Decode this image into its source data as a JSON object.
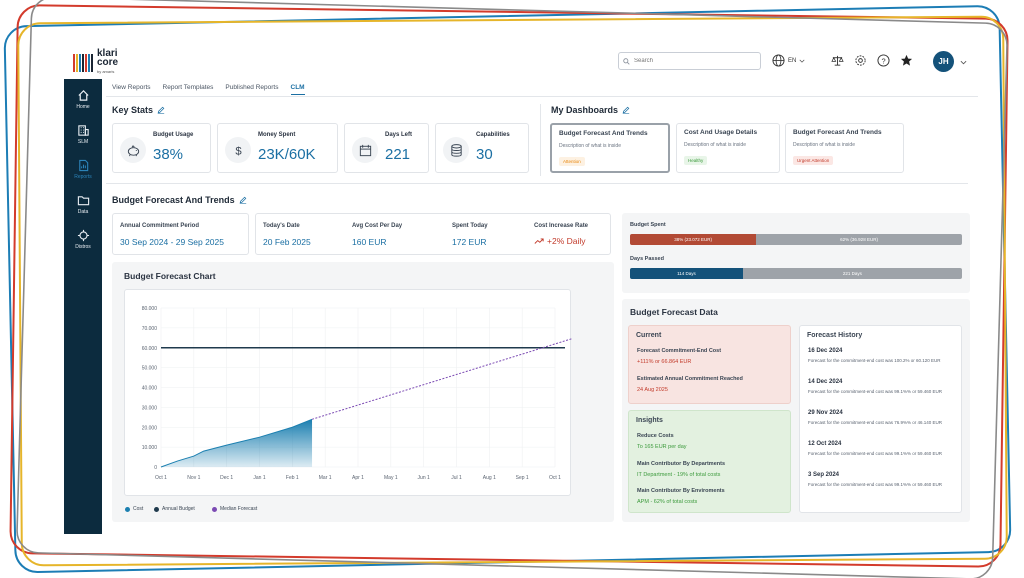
{
  "app": {
    "logo_text_1": "klari",
    "logo_text_2": "core",
    "logo_sub": "by amaris"
  },
  "header": {
    "search_placeholder": "Search",
    "language": "EN",
    "user_initials": "JH"
  },
  "sidebar": {
    "items": [
      {
        "label": "Home",
        "icon": "home-icon"
      },
      {
        "label": "SLM",
        "icon": "building-icon"
      },
      {
        "label": "Reports",
        "icon": "report-icon",
        "active": true
      },
      {
        "label": "Data",
        "icon": "folder-icon"
      },
      {
        "label": "Distros",
        "icon": "distros-icon"
      }
    ]
  },
  "tabs": [
    {
      "label": "View Reports"
    },
    {
      "label": "Report Templates"
    },
    {
      "label": "Published Reports"
    },
    {
      "label": "CLM",
      "active": true
    }
  ],
  "key_stats": {
    "title": "Key Stats",
    "items": [
      {
        "label": "Budget Usage",
        "value": "38%",
        "icon": "piggy-bank-icon"
      },
      {
        "label": "Money Spent",
        "value": "23K/60K",
        "icon": "dollar-icon"
      },
      {
        "label": "Days Left",
        "value": "221",
        "icon": "calendar-icon"
      },
      {
        "label": "Capabilities",
        "value": "30",
        "icon": "database-icon"
      }
    ]
  },
  "my_dashboards": {
    "title": "My Dashboards",
    "items": [
      {
        "title": "Budget Forecast And Trends",
        "description": "Description of what is inside",
        "badge": "Attention",
        "badge_color": "#e8860c",
        "badge_bg": "#fdf1e2"
      },
      {
        "title": "Cost And Usage Details",
        "description": "Description of what is inside",
        "badge": "Healthy",
        "badge_color": "#3c9a3c",
        "badge_bg": "#e8f5e8"
      },
      {
        "title": "Budget Forecast And Trends",
        "description": "Description of what is inside",
        "badge": "Urgent Attention",
        "badge_color": "#c23a2a",
        "badge_bg": "#fbe7e4"
      }
    ]
  },
  "trends": {
    "title": "Budget Forecast And Trends",
    "period_label": "Annual Commitment Period",
    "period_value": "30 Sep 2024 - 29 Sep 2025",
    "metrics": [
      {
        "label": "Today's Date",
        "value": "20 Feb 2025"
      },
      {
        "label": "Avg Cost Per Day",
        "value": "160 EUR"
      },
      {
        "label": "Spent Today",
        "value": "172 EUR"
      },
      {
        "label": "Cost Increase Rate",
        "value": "+2% Daily",
        "color": "#c23a2a"
      }
    ]
  },
  "progress": {
    "budget_spent_label": "Budget Spent",
    "budget_spent_fraction": 0.38,
    "budget_spent_text": "38% (23.072 EUR)",
    "budget_left_text": "62% (36.928 EUR)",
    "days_passed_label": "Days Passed",
    "days_passed_fraction": 0.34,
    "days_passed_text": "114 Days",
    "days_left_text": "221 Days",
    "spent_color": "#b24a35",
    "passed_color": "#14527a",
    "rest_color": "#9ea3a9"
  },
  "chart_data": {
    "type": "area",
    "title": "Budget Forecast Chart",
    "x_ticks": [
      "Oct 1",
      "Nov 1",
      "Dec 1",
      "Jan 1",
      "Feb 1",
      "Mar 1",
      "Apr 1",
      "May 1",
      "Jun 1",
      "Jul 1",
      "Aug 1",
      "Sep 1",
      "Oct 1"
    ],
    "y_ticks": [
      "0",
      "10.000",
      "20.000",
      "30.000",
      "40.000",
      "50.000",
      "60.000",
      "70.000",
      "80.000"
    ],
    "ylim": [
      0,
      80000
    ],
    "series": [
      {
        "name": "Cost",
        "color": "#1b7fb0",
        "x": [
          0,
          0.5,
          1,
          1.3,
          2,
          3,
          4,
          4.6
        ],
        "y": [
          0,
          3000,
          5500,
          8000,
          11000,
          15000,
          20000,
          24000
        ]
      },
      {
        "name": "Annual Budget",
        "color": "#1f3a4d",
        "value": 60000
      },
      {
        "name": "Median Forecast",
        "color": "#7b4ab3",
        "x": [
          4.6,
          12.6
        ],
        "y": [
          24000,
          65000
        ]
      }
    ],
    "legend_position": "bottom-left"
  },
  "forecast_data": {
    "title": "Budget Forecast Data",
    "current": {
      "title": "Current",
      "label_1": "Forecast Commitment-End Cost",
      "value_1": "+111% or 66.864 EUR",
      "label_2": "Estimated Annual Commitment Reached",
      "value_2": "24 Aug 2025"
    },
    "insights": {
      "title": "Insights",
      "label_1": "Reduce Costs",
      "value_1": "To 165 EUR per day",
      "label_2": "Main Contributor By Departments",
      "value_2": "IT Department - 19% of total costs",
      "label_3": "Main Contributor By Enviroments",
      "value_3": "APM - 62% of total costs"
    },
    "history": {
      "title": "Forecast History",
      "items": [
        {
          "date": "16 Dec 2024",
          "text": "Forecast for the commitment-end cost was 100.2% or 60.120 EUR"
        },
        {
          "date": "14 Dec 2024",
          "text": "Forecast for the commitment-end cost was 99.1%% or 59.460 EUR"
        },
        {
          "date": "29 Nov 2024",
          "text": "Forecast for the commitment-end cost was 76.9%% or 46.140 EUR"
        },
        {
          "date": "12 Oct 2024",
          "text": "Forecast for the commitment-end cost was 99.1%% or 59.460 EUR"
        },
        {
          "date": "3 Sep 2024",
          "text": "Forecast for the commitment-end cost was 99.1%% or 59.460 EUR"
        }
      ]
    }
  }
}
